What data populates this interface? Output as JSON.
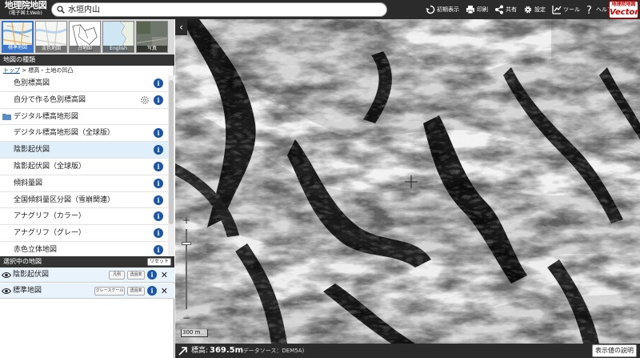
{
  "app": {
    "logo_line1": "地理院地図",
    "logo_line2": "(電子国土Web)",
    "vector_logo_line1": "地理院地図",
    "vector_logo_line2": "Vector"
  },
  "search": {
    "value": "水垣内山"
  },
  "toolbar": [
    {
      "label": "初期表示",
      "icon": "reset-view-icon"
    },
    {
      "label": "印刷",
      "icon": "print-icon"
    },
    {
      "label": "共有",
      "icon": "share-icon"
    },
    {
      "label": "設定",
      "icon": "gear-icon"
    },
    {
      "label": "ツール",
      "icon": "tool-icon"
    },
    {
      "label": "ヘルプ",
      "icon": "help-icon"
    }
  ],
  "basemaps": [
    {
      "label": "標準地図",
      "active": true
    },
    {
      "label": "淡色地図",
      "active": false
    },
    {
      "label": "白地図",
      "active": false
    },
    {
      "label": "English",
      "active": false
    },
    {
      "label": "写真",
      "active": false
    }
  ],
  "layer_panel": {
    "title": "地図の種類",
    "breadcrumb_link": "トップ",
    "breadcrumb_rest": " > 標高・土地の凹凸",
    "items": [
      {
        "label": "色別標高図",
        "type": "item"
      },
      {
        "label": "自分で作る色別標高図",
        "type": "item-gear"
      },
      {
        "label": "デジタル標高地形図",
        "type": "folder"
      },
      {
        "label": "デジタル標高地形図（全球版）",
        "type": "item"
      },
      {
        "label": "陰影起伏図",
        "type": "selected"
      },
      {
        "label": "陰影起伏図（全球版）",
        "type": "item"
      },
      {
        "label": "傾斜量図",
        "type": "item"
      },
      {
        "label": "全国傾斜量区分図（雪崩関連）",
        "type": "item"
      },
      {
        "label": "アナグリフ（カラー）",
        "type": "item"
      },
      {
        "label": "アナグリフ（グレー）",
        "type": "item"
      },
      {
        "label": "赤色立体地図",
        "type": "item"
      }
    ]
  },
  "selected_panel": {
    "title": "選択中の地図",
    "reset_label": "リセット",
    "rows": [
      {
        "label": "陰影起伏図",
        "pill1": "凡例",
        "pill2": "透過率"
      },
      {
        "label": "標準地図",
        "pill1": "グレースケール",
        "pill2": "透過率"
      }
    ]
  },
  "map": {
    "collapse_label": "‹",
    "zoom_in": "+",
    "zoom_out": "−",
    "zoom_level": 0.85,
    "scale_label": "300 m"
  },
  "footer": {
    "elev_label": "標高:",
    "elev_value": "369.5m",
    "source": "(データソース：DEM5A)",
    "legend_button": "表示値の説明"
  }
}
